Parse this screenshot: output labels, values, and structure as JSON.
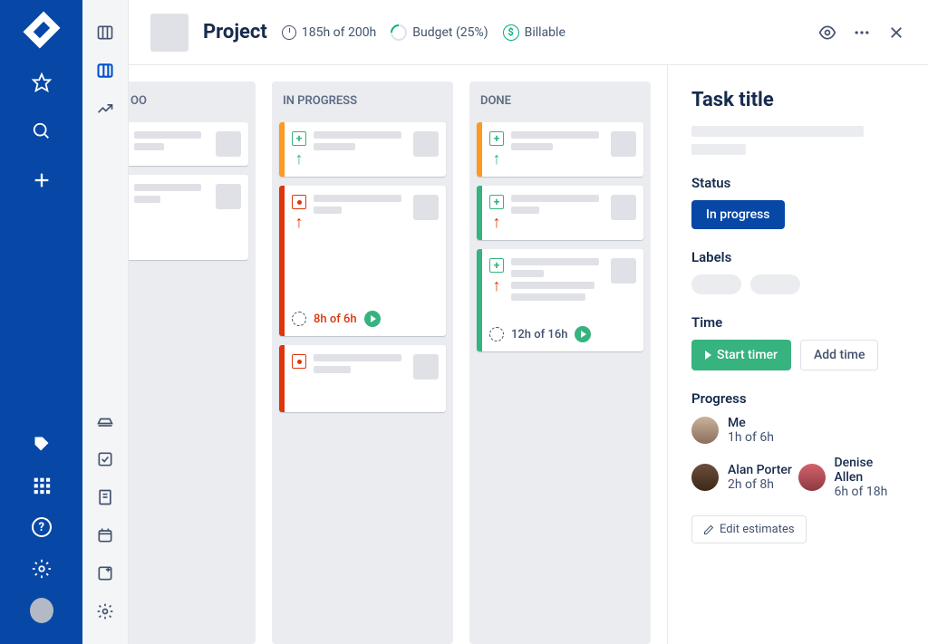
{
  "header": {
    "project_name": "Project",
    "time_budget": "185h of 200h",
    "budget_label": "Budget (25%)",
    "billable_label": "Billable"
  },
  "columns": [
    {
      "title": "OO"
    },
    {
      "title": "IN PROGRESS"
    },
    {
      "title": "DONE"
    }
  ],
  "cards": {
    "inprogress_overflow": "8h of 6h",
    "done_time": "12h of 16h"
  },
  "detail": {
    "title": "Task title",
    "status_label": "Status",
    "status_value": "In progress",
    "labels_label": "Labels",
    "time_label": "Time",
    "start_timer": "Start timer",
    "add_time": "Add time",
    "progress_label": "Progress",
    "progress": [
      {
        "name": "Me",
        "time": "1h of 6h"
      },
      {
        "name": "Alan Porter",
        "time": "2h of 8h"
      },
      {
        "name": "Denise Allen",
        "time": "6h of 18h"
      }
    ],
    "edit_estimates": "Edit estimates"
  }
}
